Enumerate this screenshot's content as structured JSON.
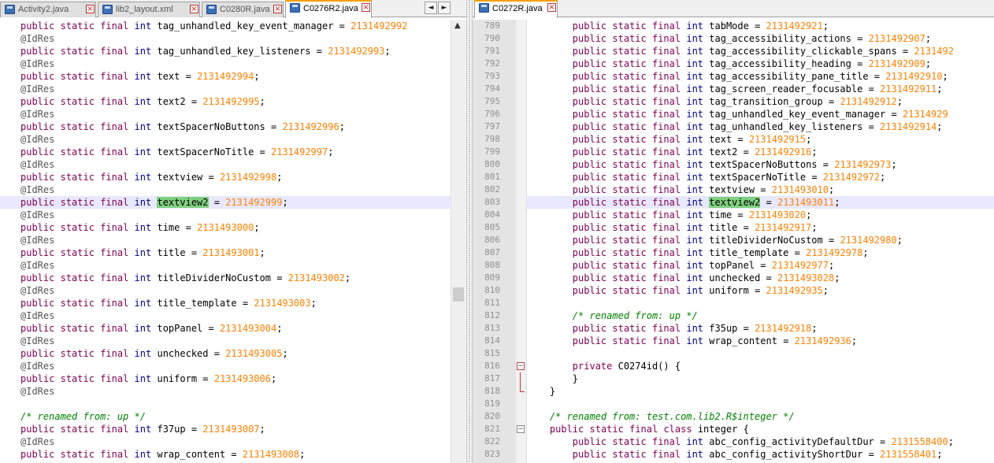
{
  "left_tabs": [
    {
      "label": "Activity2.java",
      "active": false
    },
    {
      "label": "lib2_layout.xml",
      "active": false
    },
    {
      "label": "C0280R.java",
      "active": false
    },
    {
      "label": "C0276R2.java",
      "active": true
    }
  ],
  "right_tabs": [
    {
      "label": "C0272R.java",
      "active": true
    }
  ],
  "scroll_arrows": {
    "left": "◄",
    "right": "►"
  },
  "left_code": [
    {
      "t": "field",
      "name": "tag_unhandled_key_event_manager",
      "value": "2131492992",
      "suffix": ""
    },
    {
      "t": "ann",
      "text": "@IdRes"
    },
    {
      "t": "field",
      "name": "tag_unhandled_key_listeners",
      "value": "2131492993",
      "suffix": ";"
    },
    {
      "t": "ann",
      "text": "@IdRes"
    },
    {
      "t": "field",
      "name": "text",
      "value": "2131492994",
      "suffix": ";"
    },
    {
      "t": "ann",
      "text": "@IdRes"
    },
    {
      "t": "field",
      "name": "text2",
      "value": "2131492995",
      "suffix": ";"
    },
    {
      "t": "ann",
      "text": "@IdRes"
    },
    {
      "t": "field",
      "name": "textSpacerNoButtons",
      "value": "2131492996",
      "suffix": ";"
    },
    {
      "t": "ann",
      "text": "@IdRes"
    },
    {
      "t": "field",
      "name": "textSpacerNoTitle",
      "value": "2131492997",
      "suffix": ";"
    },
    {
      "t": "ann",
      "text": "@IdRes"
    },
    {
      "t": "field",
      "name": "textview",
      "value": "2131492998",
      "suffix": ";"
    },
    {
      "t": "ann",
      "text": "@IdRes"
    },
    {
      "t": "field",
      "name": "textview2",
      "value": "2131492999",
      "suffix": ";",
      "highlight": true
    },
    {
      "t": "ann",
      "text": "@IdRes"
    },
    {
      "t": "field",
      "name": "time",
      "value": "2131493000",
      "suffix": ";"
    },
    {
      "t": "ann",
      "text": "@IdRes"
    },
    {
      "t": "field",
      "name": "title",
      "value": "2131493001",
      "suffix": ";"
    },
    {
      "t": "ann",
      "text": "@IdRes"
    },
    {
      "t": "field",
      "name": "titleDividerNoCustom",
      "value": "2131493002",
      "suffix": ";"
    },
    {
      "t": "ann",
      "text": "@IdRes"
    },
    {
      "t": "field",
      "name": "title_template",
      "value": "2131493003",
      "suffix": ";"
    },
    {
      "t": "ann",
      "text": "@IdRes"
    },
    {
      "t": "field",
      "name": "topPanel",
      "value": "2131493004",
      "suffix": ";"
    },
    {
      "t": "ann",
      "text": "@IdRes"
    },
    {
      "t": "field",
      "name": "unchecked",
      "value": "2131493005",
      "suffix": ";"
    },
    {
      "t": "ann",
      "text": "@IdRes"
    },
    {
      "t": "field",
      "name": "uniform",
      "value": "2131493006",
      "suffix": ";"
    },
    {
      "t": "ann",
      "text": "@IdRes"
    },
    {
      "t": "blank"
    },
    {
      "t": "comment",
      "text": "/* renamed from: up */"
    },
    {
      "t": "field",
      "name": "f37up",
      "value": "2131493007",
      "suffix": ";"
    },
    {
      "t": "ann",
      "text": "@IdRes"
    },
    {
      "t": "field",
      "name": "wrap_content",
      "value": "2131493008",
      "suffix": ";"
    }
  ],
  "right_code": [
    {
      "ln": "789",
      "t": "field",
      "name": "tabMode",
      "value": "2131492921",
      "suffix": ";"
    },
    {
      "ln": "790",
      "t": "field",
      "name": "tag_accessibility_actions",
      "value": "2131492907",
      "suffix": ";"
    },
    {
      "ln": "791",
      "t": "field",
      "name": "tag_accessibility_clickable_spans",
      "value": "2131492",
      "suffix": ""
    },
    {
      "ln": "792",
      "t": "field",
      "name": "tag_accessibility_heading",
      "value": "2131492909",
      "suffix": ";"
    },
    {
      "ln": "793",
      "t": "field",
      "name": "tag_accessibility_pane_title",
      "value": "2131492910",
      "suffix": ";"
    },
    {
      "ln": "794",
      "t": "field",
      "name": "tag_screen_reader_focusable",
      "value": "2131492911",
      "suffix": ";"
    },
    {
      "ln": "795",
      "t": "field",
      "name": "tag_transition_group",
      "value": "2131492912",
      "suffix": ";"
    },
    {
      "ln": "796",
      "t": "field",
      "name": "tag_unhandled_key_event_manager",
      "value": "21314929",
      "suffix": ""
    },
    {
      "ln": "797",
      "t": "field",
      "name": "tag_unhandled_key_listeners",
      "value": "2131492914",
      "suffix": ";"
    },
    {
      "ln": "798",
      "t": "field",
      "name": "text",
      "value": "2131492915",
      "suffix": ";"
    },
    {
      "ln": "799",
      "t": "field",
      "name": "text2",
      "value": "2131492916",
      "suffix": ";"
    },
    {
      "ln": "800",
      "t": "field",
      "name": "textSpacerNoButtons",
      "value": "2131492973",
      "suffix": ";"
    },
    {
      "ln": "801",
      "t": "field",
      "name": "textSpacerNoTitle",
      "value": "2131492972",
      "suffix": ";"
    },
    {
      "ln": "802",
      "t": "field",
      "name": "textview",
      "value": "2131493010",
      "suffix": ";"
    },
    {
      "ln": "803",
      "t": "field",
      "name": "textview2",
      "value": "2131493011",
      "suffix": ";",
      "highlight": true
    },
    {
      "ln": "804",
      "t": "field",
      "name": "time",
      "value": "2131493020",
      "suffix": ";"
    },
    {
      "ln": "805",
      "t": "field",
      "name": "title",
      "value": "2131492917",
      "suffix": ";"
    },
    {
      "ln": "806",
      "t": "field",
      "name": "titleDividerNoCustom",
      "value": "2131492980",
      "suffix": ";"
    },
    {
      "ln": "807",
      "t": "field",
      "name": "title_template",
      "value": "2131492978",
      "suffix": ";"
    },
    {
      "ln": "808",
      "t": "field",
      "name": "topPanel",
      "value": "2131492977",
      "suffix": ";"
    },
    {
      "ln": "809",
      "t": "field",
      "name": "unchecked",
      "value": "2131493028",
      "suffix": ";"
    },
    {
      "ln": "810",
      "t": "field",
      "name": "uniform",
      "value": "2131492935",
      "suffix": ";"
    },
    {
      "ln": "811",
      "t": "blank"
    },
    {
      "ln": "812",
      "t": "comment",
      "text": "    /* renamed from: up */"
    },
    {
      "ln": "813",
      "t": "field",
      "name": "f35up",
      "value": "2131492918",
      "suffix": ";"
    },
    {
      "ln": "814",
      "t": "field",
      "name": "wrap_content",
      "value": "2131492936",
      "suffix": ";"
    },
    {
      "ln": "815",
      "t": "blank"
    },
    {
      "ln": "816",
      "t": "ctor",
      "text": "C0274id() {",
      "fold": "box"
    },
    {
      "ln": "817",
      "t": "raw",
      "text": "    }",
      "fold": "line"
    },
    {
      "ln": "818",
      "t": "raw",
      "text": "}",
      "fold": "end"
    },
    {
      "ln": "819",
      "t": "blank"
    },
    {
      "ln": "820",
      "t": "comment",
      "text": "/* renamed from: test.com.lib2.R$integer */"
    },
    {
      "ln": "821",
      "t": "class",
      "text": "integer {",
      "fold": "plain"
    },
    {
      "ln": "822",
      "t": "field",
      "name": "abc_config_activityDefaultDur",
      "value": "2131558400",
      "suffix": ";"
    },
    {
      "ln": "823",
      "t": "field",
      "name": "abc_config_activityShortDur",
      "value": "2131558401",
      "suffix": ";"
    }
  ],
  "tokens": {
    "public": "public",
    "static": "static",
    "final": "final",
    "int": "int",
    "private": "private",
    "class": "class",
    "eq": " = "
  },
  "colors": {
    "keyword": "#7f0055",
    "number": "#ff8000",
    "comment": "#008000",
    "highlight": "#7fd07f",
    "current_line": "#e8e8ff"
  }
}
